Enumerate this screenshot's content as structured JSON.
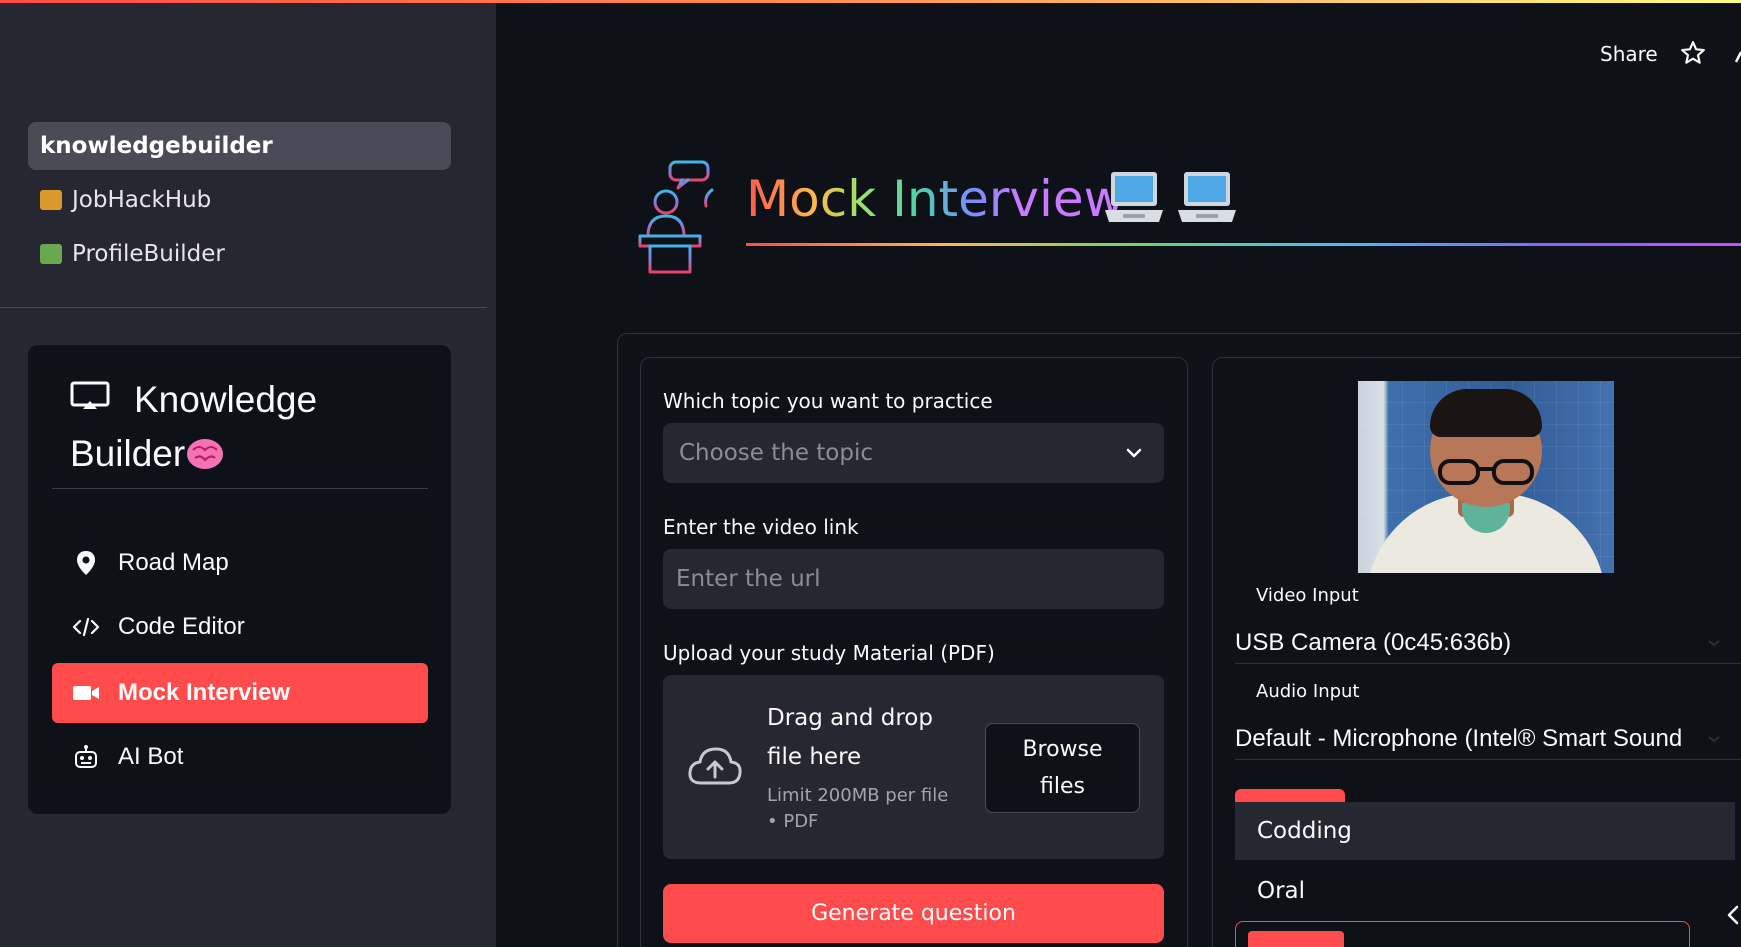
{
  "sidebar": {
    "pages": [
      {
        "label": "knowledgebuilder",
        "active": true
      },
      {
        "label": "JobHackHub",
        "emoji_color": "#d99a2b"
      },
      {
        "label": "ProfileBuilder",
        "emoji_color": "#6aa84f"
      }
    ],
    "card": {
      "title_line1": "Knowledge",
      "title_line2": "Builder",
      "menu": [
        {
          "label": "Road Map",
          "icon": "map-pin-icon"
        },
        {
          "label": "Code Editor",
          "icon": "code-icon"
        },
        {
          "label": "Mock Interview",
          "icon": "video-camera-icon",
          "active": true
        },
        {
          "label": "AI Bot",
          "icon": "robot-icon"
        }
      ]
    }
  },
  "header": {
    "share_label": "Share",
    "title": "Mock Interview"
  },
  "form": {
    "topic_label": "Which topic you want to practice",
    "topic_placeholder": "Choose the topic",
    "video_label": "Enter the video link",
    "video_placeholder": "Enter the url",
    "upload_label": "Upload your study Material (PDF)",
    "dropzone_text": "Drag and drop file here",
    "dropzone_limit": "Limit 200MB per file • PDF",
    "browse_label": "Browse files",
    "generate_label": "Generate question"
  },
  "webcam": {
    "video_input_label": "Video Input",
    "video_input_value": "USB Camera (0c45:636b)",
    "audio_input_label": "Audio Input",
    "audio_input_value": "Default - Microphone (Intel® Smart Sound",
    "dropdown_options": [
      "Codding",
      "Oral"
    ]
  },
  "colors": {
    "accent": "#ff4b4b",
    "sidebar_bg": "#262730",
    "app_bg": "#0e1117"
  }
}
